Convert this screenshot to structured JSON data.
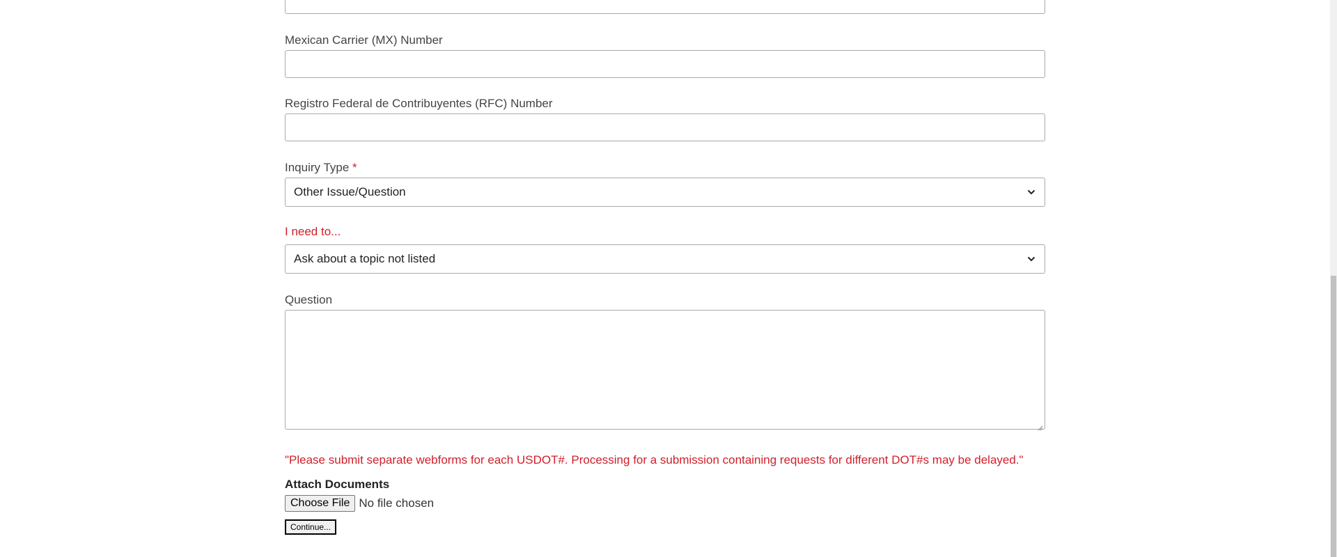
{
  "form": {
    "prev_field": {
      "value": ""
    },
    "mx_number": {
      "label": "Mexican Carrier (MX) Number",
      "value": ""
    },
    "rfc_number": {
      "label": "Registro Federal de Contribuyentes (RFC) Number",
      "value": ""
    },
    "inquiry_type": {
      "label": "Inquiry Type",
      "required_marker": "*",
      "selected": "Other Issue/Question"
    },
    "need_to": {
      "label": "I need to...",
      "selected": "Ask about a topic not listed"
    },
    "question": {
      "label": "Question",
      "value": ""
    },
    "notice": "\"Please submit separate webforms for each USDOT#. Processing for a submission containing requests for different DOT#s may be delayed.\"",
    "attach": {
      "title": "Attach Documents",
      "choose_label": "Choose File",
      "status": "No file chosen"
    },
    "continue_label": "Continue..."
  },
  "icons": {
    "select_chevron": "chevron-down-icon",
    "textarea_grip": "resize-grip-icon"
  },
  "colors": {
    "label": "#444444",
    "alert_red": "#d0202a",
    "border": "#a9a9a9"
  }
}
